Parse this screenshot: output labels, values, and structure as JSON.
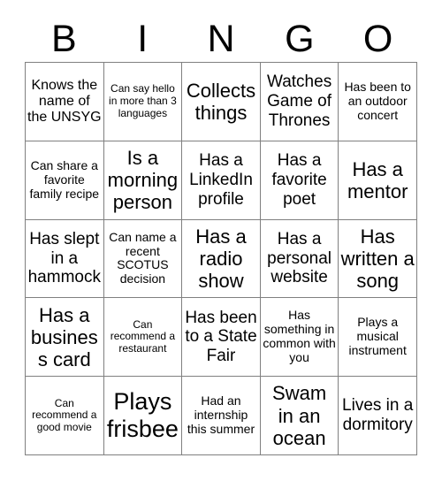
{
  "header": {
    "letters": [
      "B",
      "I",
      "N",
      "G",
      "O"
    ]
  },
  "colors": {
    "background": "#ffffff",
    "text": "#000000",
    "grid_line": "#808080"
  },
  "grid": {
    "columns": 5,
    "rows": 5,
    "cells": [
      {
        "text": "Knows the name of the UNSYG",
        "size": "fs-md"
      },
      {
        "text": "Can say hello in more than 3 languages",
        "size": "fs-xs"
      },
      {
        "text": "Collects things",
        "size": "fs-xl"
      },
      {
        "text": "Watches Game of Thrones",
        "size": "fs-lg"
      },
      {
        "text": "Has been to an outdoor concert",
        "size": "fs-sm"
      },
      {
        "text": "Can share a favorite family recipe",
        "size": "fs-sm"
      },
      {
        "text": "Is a morning person",
        "size": "fs-xl"
      },
      {
        "text": "Has a LinkedIn profile",
        "size": "fs-lg"
      },
      {
        "text": "Has a favorite poet",
        "size": "fs-lg"
      },
      {
        "text": "Has a mentor",
        "size": "fs-xl"
      },
      {
        "text": "Has slept in a hammock",
        "size": "fs-lg"
      },
      {
        "text": "Can name a recent SCOTUS decision",
        "size": "fs-sm"
      },
      {
        "text": "Has a radio show",
        "size": "fs-xl"
      },
      {
        "text": "Has a personal website",
        "size": "fs-lg"
      },
      {
        "text": "Has written a song",
        "size": "fs-xl"
      },
      {
        "text": "Has a business card",
        "size": "fs-xl"
      },
      {
        "text": "Can recommend a restaurant",
        "size": "fs-xs"
      },
      {
        "text": "Has been to a State Fair",
        "size": "fs-lg"
      },
      {
        "text": "Has something in common with you",
        "size": "fs-sm"
      },
      {
        "text": "Plays a musical instrument",
        "size": "fs-sm"
      },
      {
        "text": "Can recommend a good movie",
        "size": "fs-xs"
      },
      {
        "text": "Plays frisbee",
        "size": "fs-xxl"
      },
      {
        "text": "Had an internship this summer",
        "size": "fs-sm"
      },
      {
        "text": "Swam in an ocean",
        "size": "fs-xl"
      },
      {
        "text": "Lives in a dormitory",
        "size": "fs-lg"
      }
    ]
  }
}
